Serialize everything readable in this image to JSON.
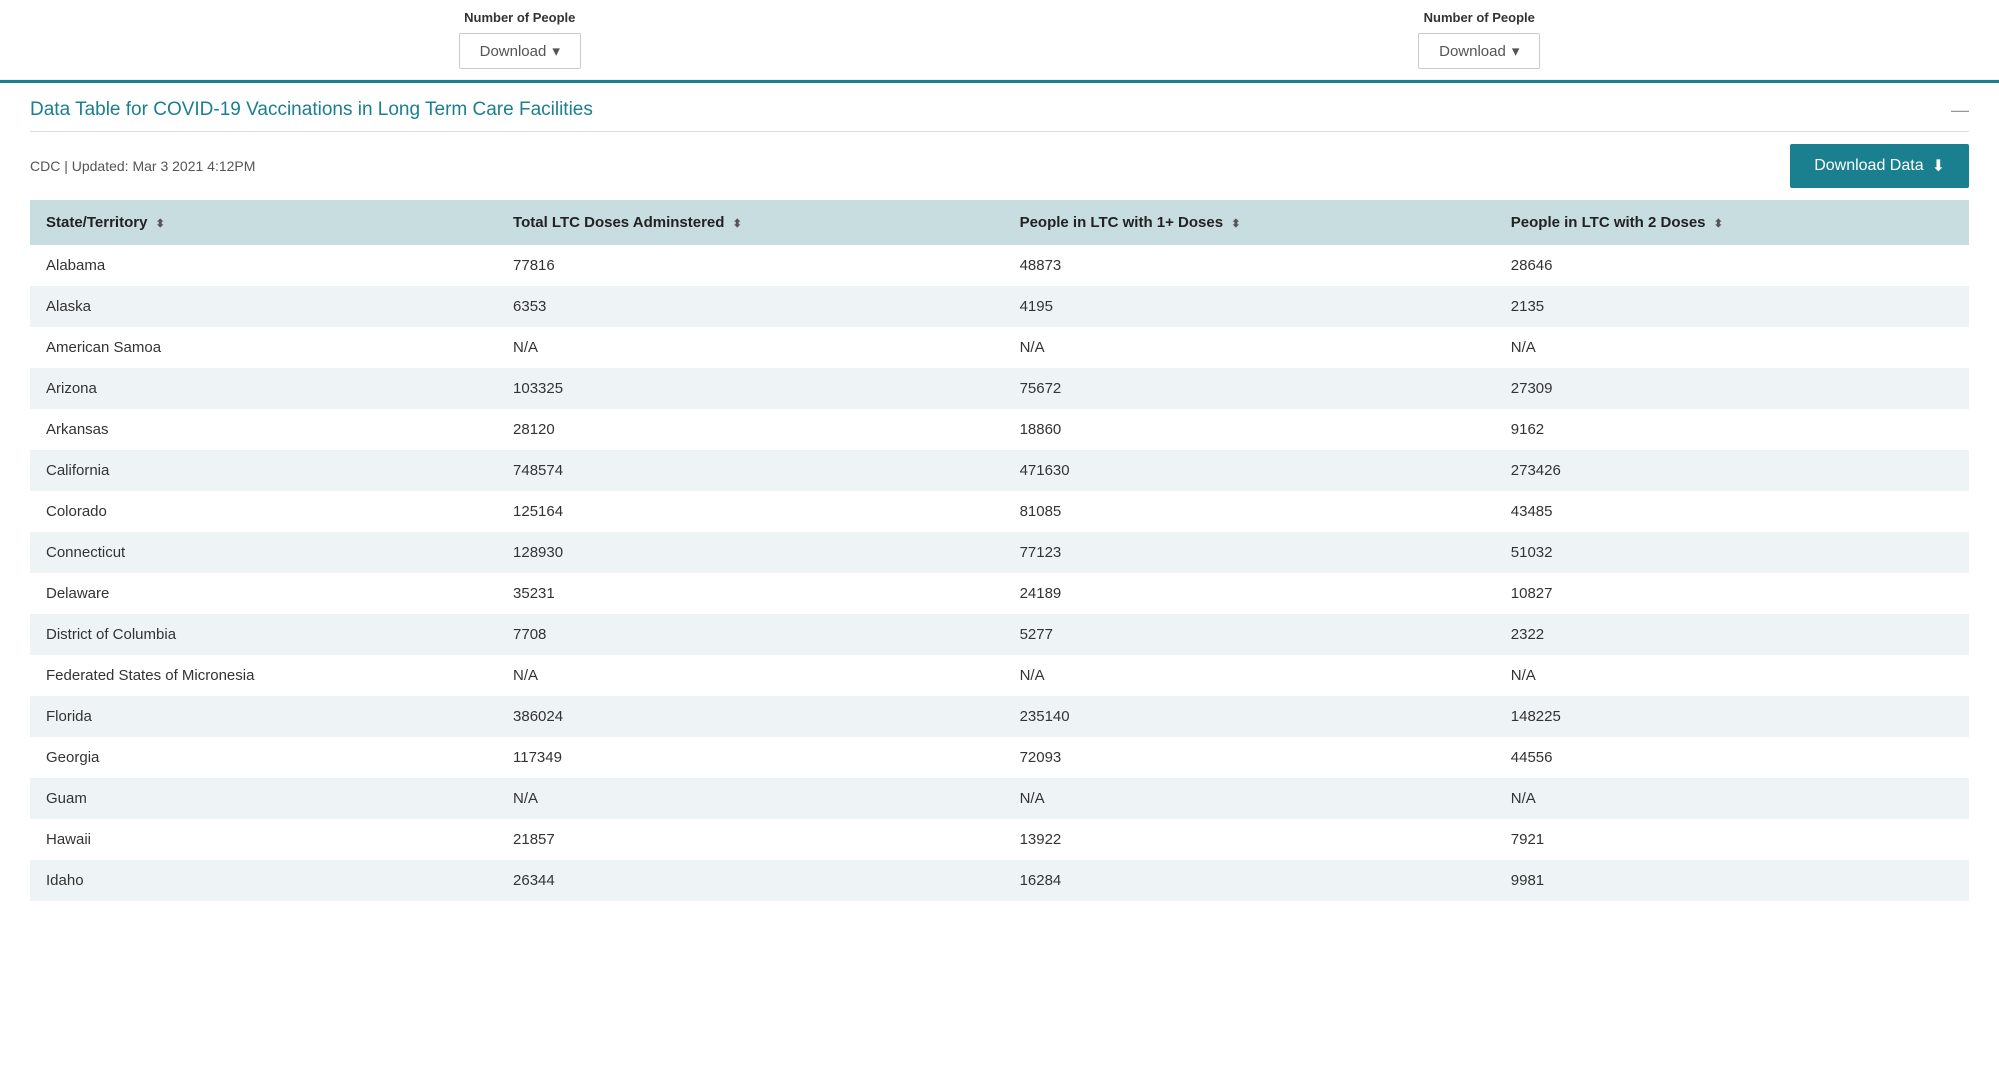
{
  "top": {
    "left_label": "Number of People",
    "right_label": "Number of People",
    "download_label": "Download",
    "download_chevron": "▾"
  },
  "section": {
    "title": "Data Table for COVID-19 Vaccinations in Long Term Care Facilities",
    "minimize": "—",
    "meta": "CDC | Updated: Mar 3 2021 4:12PM",
    "download_data_label": "Download Data",
    "download_icon": "⬇"
  },
  "table": {
    "columns": [
      "State/Territory",
      "Total LTC Doses Adminstered",
      "People in LTC with 1+ Doses",
      "People in LTC with 2 Doses"
    ],
    "rows": [
      [
        "Alabama",
        "77816",
        "48873",
        "28646"
      ],
      [
        "Alaska",
        "6353",
        "4195",
        "2135"
      ],
      [
        "American Samoa",
        "N/A",
        "N/A",
        "N/A"
      ],
      [
        "Arizona",
        "103325",
        "75672",
        "27309"
      ],
      [
        "Arkansas",
        "28120",
        "18860",
        "9162"
      ],
      [
        "California",
        "748574",
        "471630",
        "273426"
      ],
      [
        "Colorado",
        "125164",
        "81085",
        "43485"
      ],
      [
        "Connecticut",
        "128930",
        "77123",
        "51032"
      ],
      [
        "Delaware",
        "35231",
        "24189",
        "10827"
      ],
      [
        "District of Columbia",
        "7708",
        "5277",
        "2322"
      ],
      [
        "Federated States of Micronesia",
        "N/A",
        "N/A",
        "N/A"
      ],
      [
        "Florida",
        "386024",
        "235140",
        "148225"
      ],
      [
        "Georgia",
        "117349",
        "72093",
        "44556"
      ],
      [
        "Guam",
        "N/A",
        "N/A",
        "N/A"
      ],
      [
        "Hawaii",
        "21857",
        "13922",
        "7921"
      ],
      [
        "Idaho",
        "26344",
        "16284",
        "9981"
      ]
    ]
  }
}
